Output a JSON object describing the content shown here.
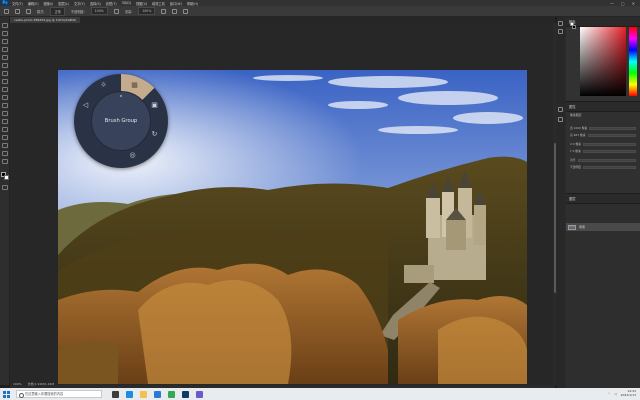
{
  "app": {
    "menu_items": [
      "文件(F)",
      "编辑(E)",
      "图像(I)",
      "图层(L)",
      "文字(Y)",
      "选择(S)",
      "滤镜(T)",
      "3D(D)",
      "视图(V)",
      "增效工具",
      "窗口(W)",
      "帮助(H)"
    ],
    "window_controls": [
      "—",
      "▢",
      "✕"
    ]
  },
  "document_tab": {
    "title": "castle-photo-889329.jpg @ 100%(RGB/8)"
  },
  "options_bar": {
    "mode_label": "模式:",
    "mode_value": "正常",
    "opacity_label": "不透明度:",
    "opacity_value": "100%",
    "flow_label": "流量:",
    "flow_value": "100%"
  },
  "radial_menu": {
    "center_label": "Brush Group",
    "active_item": "grid-icon",
    "items": [
      "brightness-icon",
      "grid-icon",
      "frame-icon",
      "history-icon",
      "layers-icon",
      "volume-icon"
    ],
    "accent_color": "#c4ab8e"
  },
  "panels": {
    "color_title": "颜色",
    "properties_title": "属性",
    "properties_sub": "像素图层",
    "prop_rows": [
      "宽 1000 像素",
      "高 667 像素",
      "X 0 像素",
      "Y 0 像素",
      "对齐",
      "不透明度"
    ],
    "layers_title": "图层",
    "layer_name": "背景"
  },
  "status_bar": {
    "zoom": "100%",
    "doc_info": "文档:1.91M/1.91M"
  },
  "taskbar": {
    "search_placeholder": "在这里输入你要搜索的内容",
    "time": "14:43",
    "date": "2022/1/13"
  }
}
